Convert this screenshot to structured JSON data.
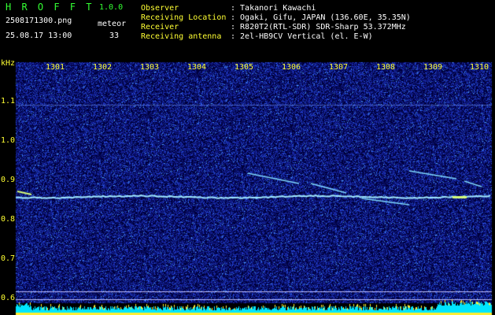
{
  "app": {
    "name": "H R O F F T",
    "version": "1.0.0",
    "filename": "2508171300.png",
    "datetime": "25.08.17 13:00",
    "meteor_label": "meteor",
    "meteor_count": "33"
  },
  "info": {
    "observer_label": "Observer",
    "observer_value": ": Takanori Kawachi",
    "location_label": "Receiving Location",
    "location_value": ": Ogaki, Gifu, JAPAN (136.60E, 35.35N)",
    "receiver_label": "Receiver",
    "receiver_value": ": R820T2(RTL-SDR) SDR-Sharp 53.372MHz",
    "antenna_label": "Receiving antenna",
    "antenna_value": ": 2el-HB9CV Vertical (el. E-W)"
  },
  "axes": {
    "y_unit": "kHz",
    "y_ticks": [
      "1.1",
      "1.0",
      "0.9",
      "0.8",
      "0.7",
      "0.6"
    ],
    "x_ticks": [
      "1301",
      "1302",
      "1303",
      "1304",
      "1305",
      "1306",
      "1307",
      "1308",
      "1309",
      "1310"
    ]
  },
  "colors": {
    "title": "#33ff33",
    "labels": "#ffff33",
    "text": "#ffffff",
    "background": "#000000",
    "noise": "#1a2aa0",
    "echo": "#aaffff",
    "level_bar": "#00e5ff"
  }
}
